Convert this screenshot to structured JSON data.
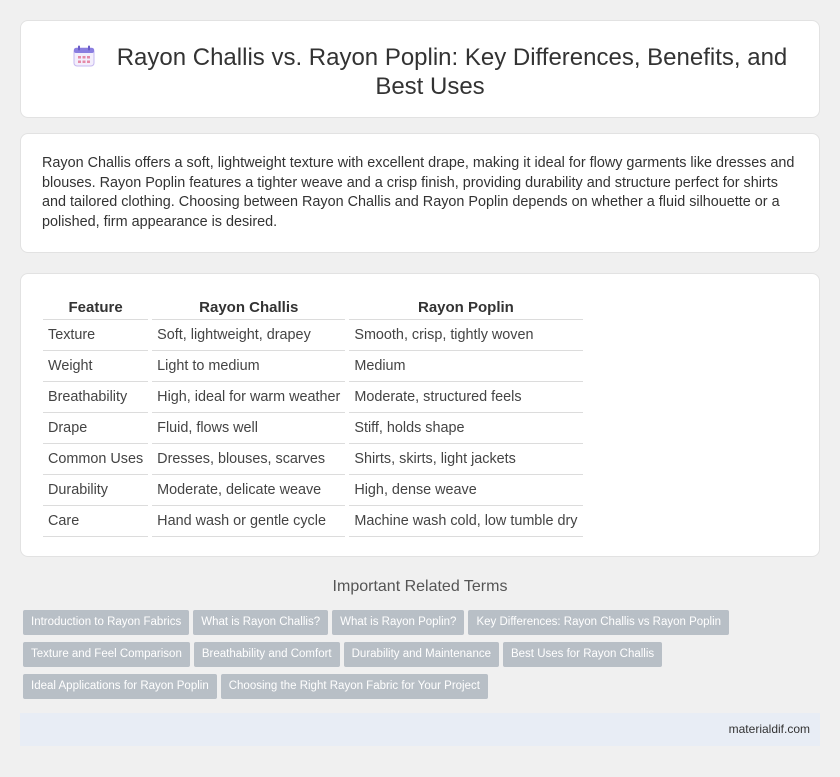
{
  "header": {
    "title": "Rayon Challis vs. Rayon Poplin: Key Differences, Benefits, and Best Uses",
    "icon": "calendar-icon"
  },
  "intro": {
    "text": "Rayon Challis offers a soft, lightweight texture with excellent drape, making it ideal for flowy garments like dresses and blouses. Rayon Poplin features a tighter weave and a crisp finish, providing durability and structure perfect for shirts and tailored clothing. Choosing between Rayon Challis and Rayon Poplin depends on whether a fluid silhouette or a polished, firm appearance is desired."
  },
  "table": {
    "headers": [
      "Feature",
      "Rayon Challis",
      "Rayon Poplin"
    ],
    "rows": [
      [
        "Texture",
        "Soft, lightweight, drapey",
        "Smooth, crisp, tightly woven"
      ],
      [
        "Weight",
        "Light to medium",
        "Medium"
      ],
      [
        "Breathability",
        "High, ideal for warm weather",
        "Moderate, structured feels"
      ],
      [
        "Drape",
        "Fluid, flows well",
        "Stiff, holds shape"
      ],
      [
        "Common Uses",
        "Dresses, blouses, scarves",
        "Shirts, skirts, light jackets"
      ],
      [
        "Durability",
        "Moderate, delicate weave",
        "High, dense weave"
      ],
      [
        "Care",
        "Hand wash or gentle cycle",
        "Machine wash cold, low tumble dry"
      ]
    ]
  },
  "related": {
    "title": "Important Related Terms",
    "tags": [
      "Introduction to Rayon Fabrics",
      "What is Rayon Challis?",
      "What is Rayon Poplin?",
      "Key Differences: Rayon Challis vs Rayon Poplin",
      "Texture and Feel Comparison",
      "Breathability and Comfort",
      "Durability and Maintenance",
      "Best Uses for Rayon Challis",
      "Ideal Applications for Rayon Poplin",
      "Choosing the Right Rayon Fabric for Your Project"
    ]
  },
  "footer": {
    "site": "materialdif.com"
  },
  "colors": {
    "tag_bg": "#b8bfc6",
    "footer_bg": "#e8edf5",
    "icon_accent": "#7b6fd6"
  }
}
